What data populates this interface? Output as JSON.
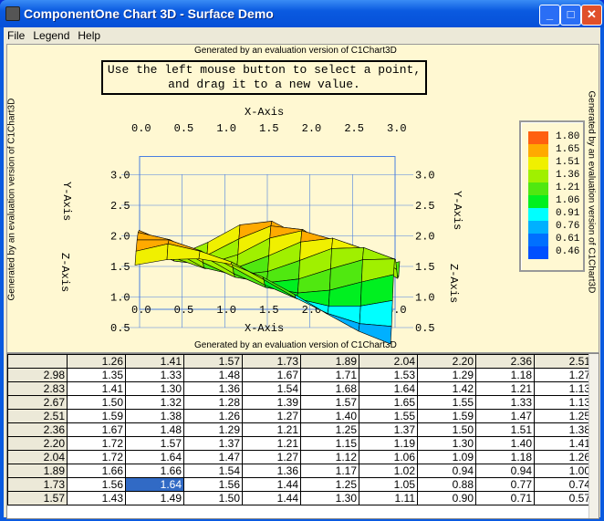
{
  "window": {
    "title": "ComponentOne Chart 3D - Surface Demo"
  },
  "menu": [
    "File",
    "Legend",
    "Help"
  ],
  "chart": {
    "eval_notice": "Generated by an evaluation version of C1Chart3D",
    "instructions_line1": "Use the left mouse button to select a point,",
    "instructions_line2": "and drag it to a new value.",
    "x_axis_label": "X-Axis",
    "y_axis_label": "Y-Axis",
    "z_axis_label": "Z-Axis",
    "x_ticks": [
      "0.0",
      "0.5",
      "1.0",
      "1.5",
      "2.0",
      "2.5",
      "3.0"
    ],
    "z_ticks": [
      "0.5",
      "1.0",
      "1.5",
      "2.0",
      "2.5",
      "3.0"
    ],
    "y_ticks": [
      "1.5",
      "2.0",
      "2.5",
      "3.0"
    ]
  },
  "legend": {
    "levels": [
      {
        "value": "1.80",
        "color": "#ff6010"
      },
      {
        "value": "1.65",
        "color": "#ffaa00"
      },
      {
        "value": "1.51",
        "color": "#f0f000"
      },
      {
        "value": "1.36",
        "color": "#a0f000"
      },
      {
        "value": "1.21",
        "color": "#50e810"
      },
      {
        "value": "1.06",
        "color": "#00f020"
      },
      {
        "value": "0.91",
        "color": "#00ffff"
      },
      {
        "value": "0.76",
        "color": "#00b0ff"
      },
      {
        "value": "0.61",
        "color": "#0070ff"
      },
      {
        "value": "0.46",
        "color": "#0050ff"
      }
    ]
  },
  "grid": {
    "col_headers": [
      "1.26",
      "1.41",
      "1.57",
      "1.73",
      "1.89",
      "2.04",
      "2.20",
      "2.36",
      "2.51"
    ],
    "selected": {
      "row": 8,
      "col": 1
    },
    "rows": [
      {
        "h": "2.98",
        "v": [
          "1.35",
          "1.33",
          "1.48",
          "1.67",
          "1.71",
          "1.53",
          "1.29",
          "1.18",
          "1.27"
        ]
      },
      {
        "h": "2.83",
        "v": [
          "1.41",
          "1.30",
          "1.36",
          "1.54",
          "1.68",
          "1.64",
          "1.42",
          "1.21",
          "1.13"
        ]
      },
      {
        "h": "2.67",
        "v": [
          "1.50",
          "1.32",
          "1.28",
          "1.39",
          "1.57",
          "1.65",
          "1.55",
          "1.33",
          "1.13"
        ]
      },
      {
        "h": "2.51",
        "v": [
          "1.59",
          "1.38",
          "1.26",
          "1.27",
          "1.40",
          "1.55",
          "1.59",
          "1.47",
          "1.25"
        ]
      },
      {
        "h": "2.36",
        "v": [
          "1.67",
          "1.48",
          "1.29",
          "1.21",
          "1.25",
          "1.37",
          "1.50",
          "1.51",
          "1.38"
        ]
      },
      {
        "h": "2.20",
        "v": [
          "1.72",
          "1.57",
          "1.37",
          "1.21",
          "1.15",
          "1.19",
          "1.30",
          "1.40",
          "1.41"
        ]
      },
      {
        "h": "2.04",
        "v": [
          "1.72",
          "1.64",
          "1.47",
          "1.27",
          "1.12",
          "1.06",
          "1.09",
          "1.18",
          "1.26"
        ]
      },
      {
        "h": "1.89",
        "v": [
          "1.66",
          "1.66",
          "1.54",
          "1.36",
          "1.17",
          "1.02",
          "0.94",
          "0.94",
          "1.00"
        ]
      },
      {
        "h": "1.73",
        "v": [
          "1.56",
          "1.64",
          "1.56",
          "1.44",
          "1.25",
          "1.05",
          "0.88",
          "0.77",
          "0.74"
        ]
      },
      {
        "h": "1.57",
        "v": [
          "1.43",
          "1.49",
          "1.50",
          "1.44",
          "1.30",
          "1.11",
          "0.90",
          "0.71",
          "0.57"
        ]
      }
    ]
  }
}
